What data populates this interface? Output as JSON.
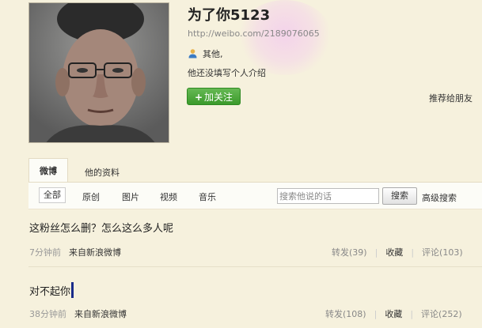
{
  "profile": {
    "name": "为了你5123",
    "url": "http://weibo.com/2189076065",
    "gender": "其他,",
    "bio": "他还没填写个人介绍",
    "follow_label": "加关注",
    "follow_plus": "+",
    "recommend_label": "推荐给朋友"
  },
  "tabs": [
    {
      "label": "微博",
      "active": true
    },
    {
      "label": "他的资料",
      "active": false
    }
  ],
  "filters": [
    "全部",
    "原创",
    "图片",
    "视频",
    "音乐"
  ],
  "search": {
    "placeholder": "搜索他说的话",
    "button": "搜索",
    "advanced": "高级搜索"
  },
  "posts": [
    {
      "text": "这粉丝怎么删？怎么这么多人呢",
      "time": "7分钟前",
      "source": "来自新浪微博",
      "repost": "转发(39)",
      "collect": "收藏",
      "comment": "评论(103)"
    },
    {
      "text": "对不起你",
      "time": "38分钟前",
      "source": "来自新浪微博",
      "repost": "转发(108)",
      "collect": "收藏",
      "comment": "评论(252)"
    }
  ],
  "colors": {
    "background": "#f6f1dd",
    "follow_green": "#3b9a2b",
    "link_gray": "#888888"
  },
  "icons": {
    "gender": "user-icon"
  }
}
